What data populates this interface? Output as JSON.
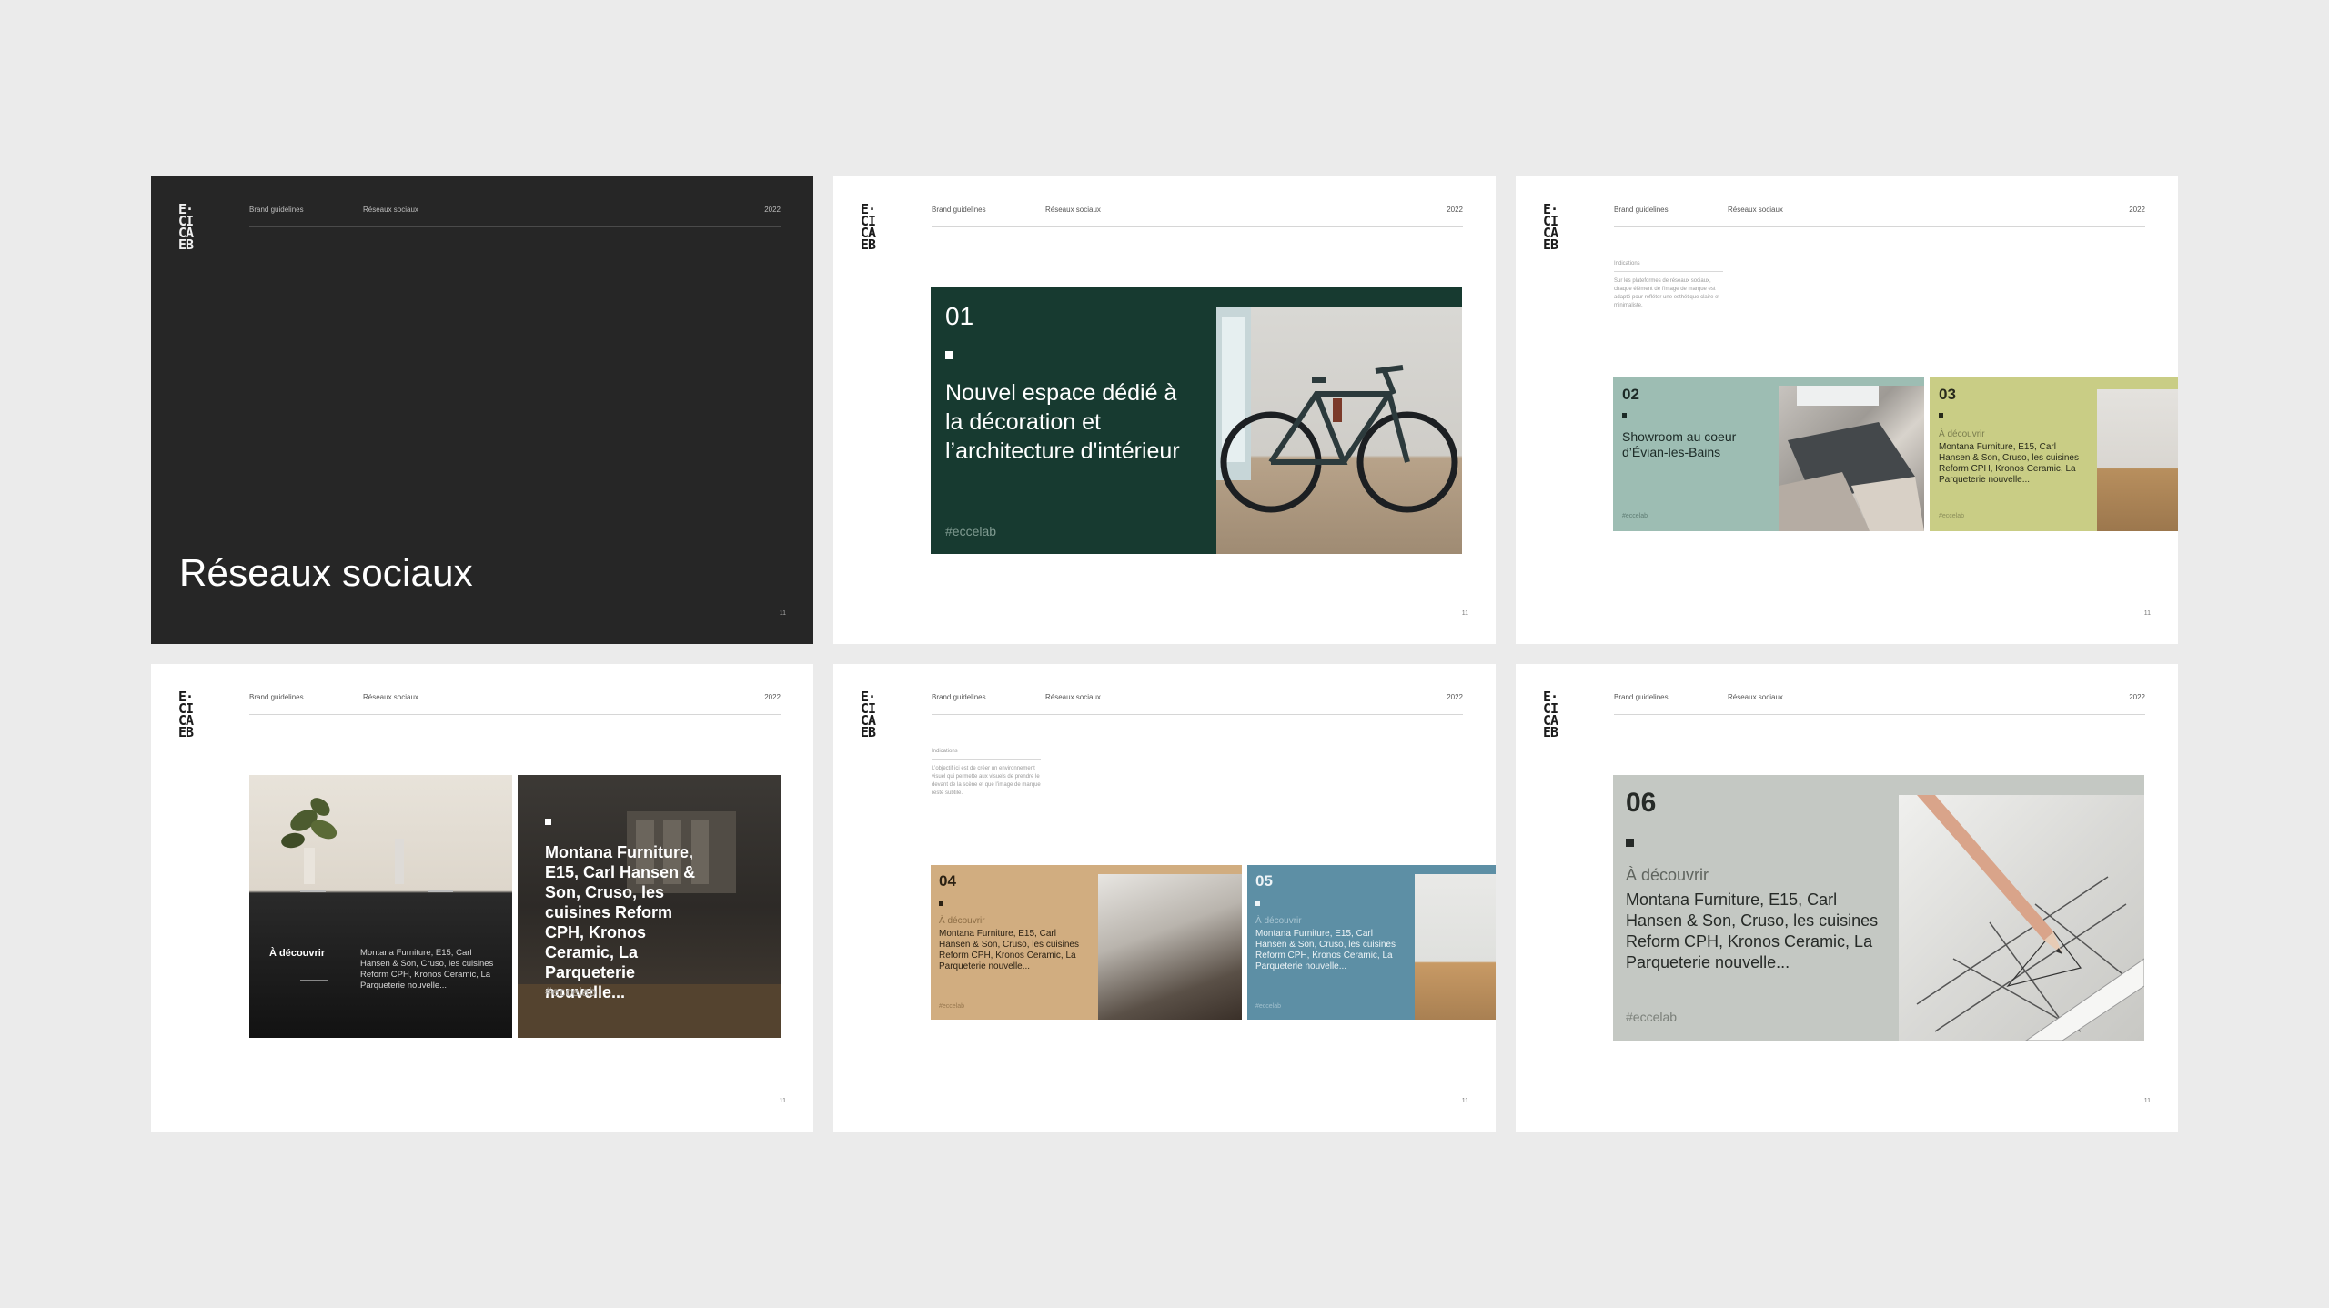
{
  "header": {
    "brand": "Brand guidelines",
    "section": "Réseaux sociaux",
    "year": "2022",
    "page": "11"
  },
  "logo": [
    "E·",
    "CI",
    "CA",
    "EB"
  ],
  "colors": {
    "background": "#ebebeb",
    "dark_slide": "#262626",
    "dark_green": "#173a30",
    "sage": "#9dbdb3",
    "olive": "#c9cd85",
    "sand": "#d1ad80",
    "steel_blue": "#5d8fa5",
    "grey": "#c4c8c3"
  },
  "slide1": {
    "title": "Réseaux sociaux"
  },
  "slide2": {
    "card": {
      "number": "01",
      "text": "Nouvel espace dédié à la décoration et l’architecture d'intérieur",
      "hashtag": "#eccelab",
      "photo": "bicycle-photo"
    }
  },
  "slide3": {
    "indications": {
      "title": "Indications",
      "text": "Sur les plateformes de réseaux sociaux, chaque élément de l'image de marque est adapté pour refléter une esthétique claire et minimaliste."
    },
    "card_a": {
      "number": "02",
      "text": "Showroom au coeur d’Évian-les-Bains",
      "hashtag": "#eccelab"
    },
    "card_b": {
      "number": "03",
      "kicker": "À découvrir",
      "text": "Montana Furniture, E15, Carl Hansen & Son, Cruso, les cuisines Reform CPH, Kronos Ceramic, La Parqueterie nouvelle...",
      "hashtag": "#eccelab"
    }
  },
  "slide4": {
    "card_a": {
      "label": "À découvrir",
      "text": "Montana Furniture, E15, Carl Hansen & Son, Cruso, les cuisines Reform CPH, Kronos Ceramic, La Parqueterie nouvelle..."
    },
    "card_b": {
      "text": "Montana Furniture, E15, Carl Hansen & Son, Cruso, les cuisines Reform CPH, Kronos Ceramic, La Parqueterie nouvelle...",
      "hashtag": "#eccelab"
    }
  },
  "slide5": {
    "indications": {
      "title": "Indications",
      "text": "L’objectif ici est de créer un environnement visuel qui permette aux visuels de prendre le devant de la scène et que l’image de marque reste subtile."
    },
    "card_a": {
      "number": "04",
      "kicker": "À découvrir",
      "text": "Montana Furniture, E15, Carl Hansen & Son, Cruso, les cuisines Reform CPH, Kronos Ceramic, La Parqueterie nouvelle...",
      "hashtag": "#eccelab"
    },
    "card_b": {
      "number": "05",
      "kicker": "À découvrir",
      "text": "Montana Furniture, E15, Carl Hansen & Son, Cruso, les cuisines Reform CPH, Kronos Ceramic, La Parqueterie nouvelle...",
      "hashtag": "#eccelab"
    }
  },
  "slide6": {
    "card": {
      "number": "06",
      "kicker": "À découvrir",
      "text": "Montana Furniture, E15, Carl Hansen & Son, Cruso, les cuisines Reform CPH, Kronos Ceramic, La Parqueterie nouvelle...",
      "hashtag": "#eccelab"
    }
  }
}
